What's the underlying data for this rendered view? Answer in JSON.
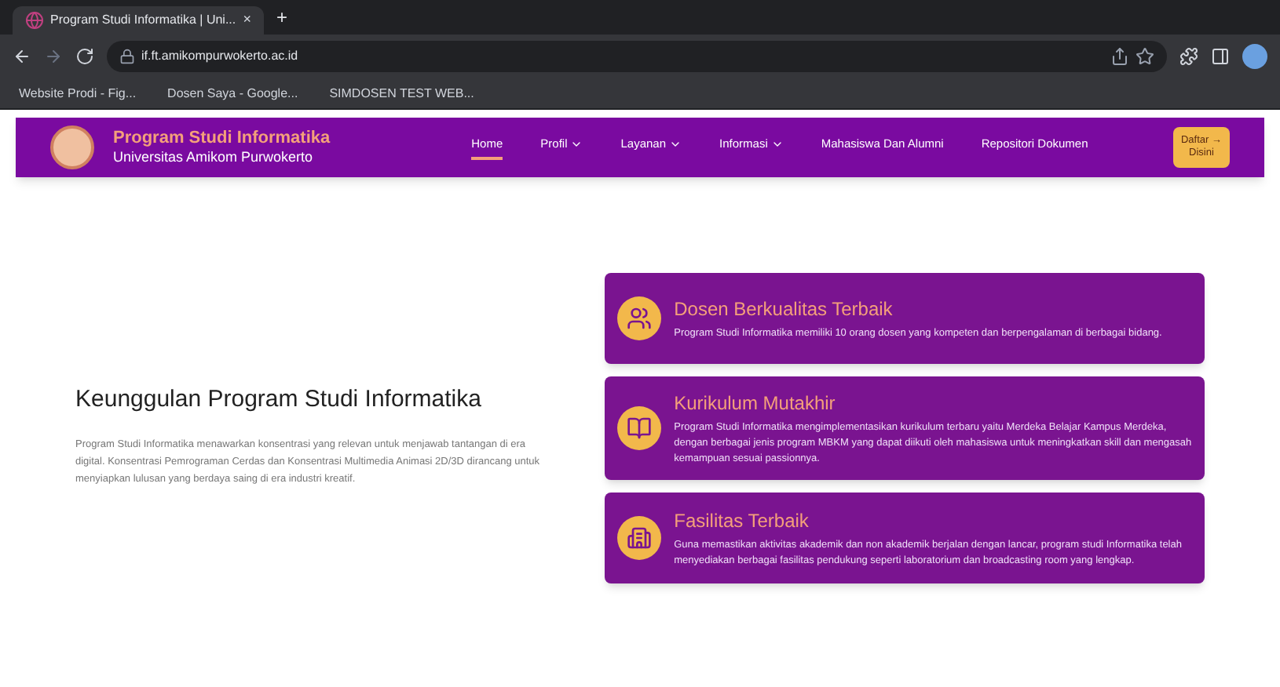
{
  "browser": {
    "tab_title": "Program Studi Informatika | Uni...",
    "tab_close": "×",
    "new_tab": "+",
    "url": "if.ft.amikompurwokerto.ac.id",
    "bookmarks": [
      "Website Prodi - Fig...",
      "Dosen Saya - Google...",
      "SIMDOSEN TEST WEB..."
    ]
  },
  "site": {
    "title": "Program Studi Informatika",
    "subtitle": "Universitas Amikom Purwokerto",
    "nav": [
      {
        "label": "Home",
        "selected": true,
        "dropdown": false
      },
      {
        "label": "Profil",
        "selected": false,
        "dropdown": true
      },
      {
        "label": "Layanan",
        "selected": false,
        "dropdown": true
      },
      {
        "label": "Informasi",
        "selected": false,
        "dropdown": true
      },
      {
        "label": "Mahasiswa Dan Alumni",
        "selected": false,
        "dropdown": false
      },
      {
        "label": "Repositori Dokumen",
        "selected": false,
        "dropdown": false
      }
    ],
    "cta": [
      "Daftar →",
      "Disini"
    ]
  },
  "intro": {
    "heading": "Keunggulan Program Studi Informatika",
    "text": "Program Studi Informatika menawarkan konsentrasi yang relevan untuk menjawab tantangan di era digital. Konsentrasi Pemrograman Cerdas dan Konsentrasi Multimedia Animasi 2D/3D dirancang untuk menyiapkan lulusan yang berdaya saing di era industri kreatif."
  },
  "features": [
    {
      "kind": "people",
      "title": "Dosen Berkualitas Terbaik",
      "text": "Program Studi Informatika memiliki 10 orang dosen yang kompeten dan berpengalaman di berbagai bidang."
    },
    {
      "kind": "book",
      "title": "Kurikulum Mutakhir",
      "text": "Program Studi Informatika mengimplementasikan kurikulum terbaru yaitu Merdeka Belajar Kampus Merdeka, dengan berbagai jenis program MBKM yang dapat diikuti oleh mahasiswa untuk meningkatkan skill dan mengasah kemampuan sesuai passionnya."
    },
    {
      "kind": "building",
      "title": "Fasilitas Terbaik",
      "text": "Guna memastikan aktivitas akademik dan non akademik berjalan dengan lancar, program studi Informatika telah menyediakan berbagai fasilitas pendukung seperti laboratorium dan broadcasting room yang lengkap."
    }
  ]
}
